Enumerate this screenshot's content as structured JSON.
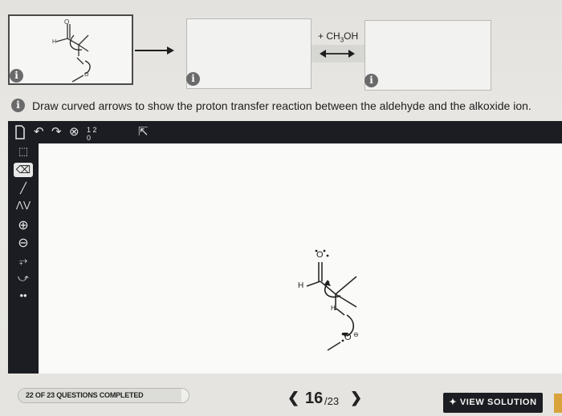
{
  "mechanism": {
    "reagent": "+ CH3OH",
    "reagent_main": "+ CH",
    "reagent_sub": "3",
    "reagent_tail": "OH",
    "info_icon_glyph": "i"
  },
  "question_text": "Draw curved arrows to show the proton transfer reaction between the aldehyde and the alkoxide ion.",
  "toolbar": {
    "icons": [
      "new-document-icon",
      "undo-icon",
      "redo-icon",
      "zoom-reset-icon",
      "numbering-icon",
      "select-cursor-icon"
    ],
    "numbering_label": "1 2 0"
  },
  "sidebar": {
    "icons": [
      "lasso-select-icon",
      "eraser-icon",
      "single-bond-icon",
      "chain-icon",
      "positive-charge-icon",
      "negative-charge-icon",
      "curved-arrow-plus-icon",
      "curved-arrow-icon",
      "lone-pair-icon"
    ],
    "active": "eraser-icon"
  },
  "molecule_labels": {
    "oxygen": "O",
    "hydrogen": "H",
    "alkoxide_oxygen": "O",
    "charge": "⊖"
  },
  "footer": {
    "progress_text": "22 OF 23 QUESTIONS COMPLETED",
    "progress_fraction": 0.957,
    "page_current": "16",
    "page_total": "/23",
    "prev_label": "❮",
    "next_label": "❯",
    "solution_label": "✦ VIEW SOLUTION"
  },
  "colors": {
    "toolbar": "#1b1d22",
    "canvas": "#fafaf9",
    "accent": "#d8a43a"
  }
}
